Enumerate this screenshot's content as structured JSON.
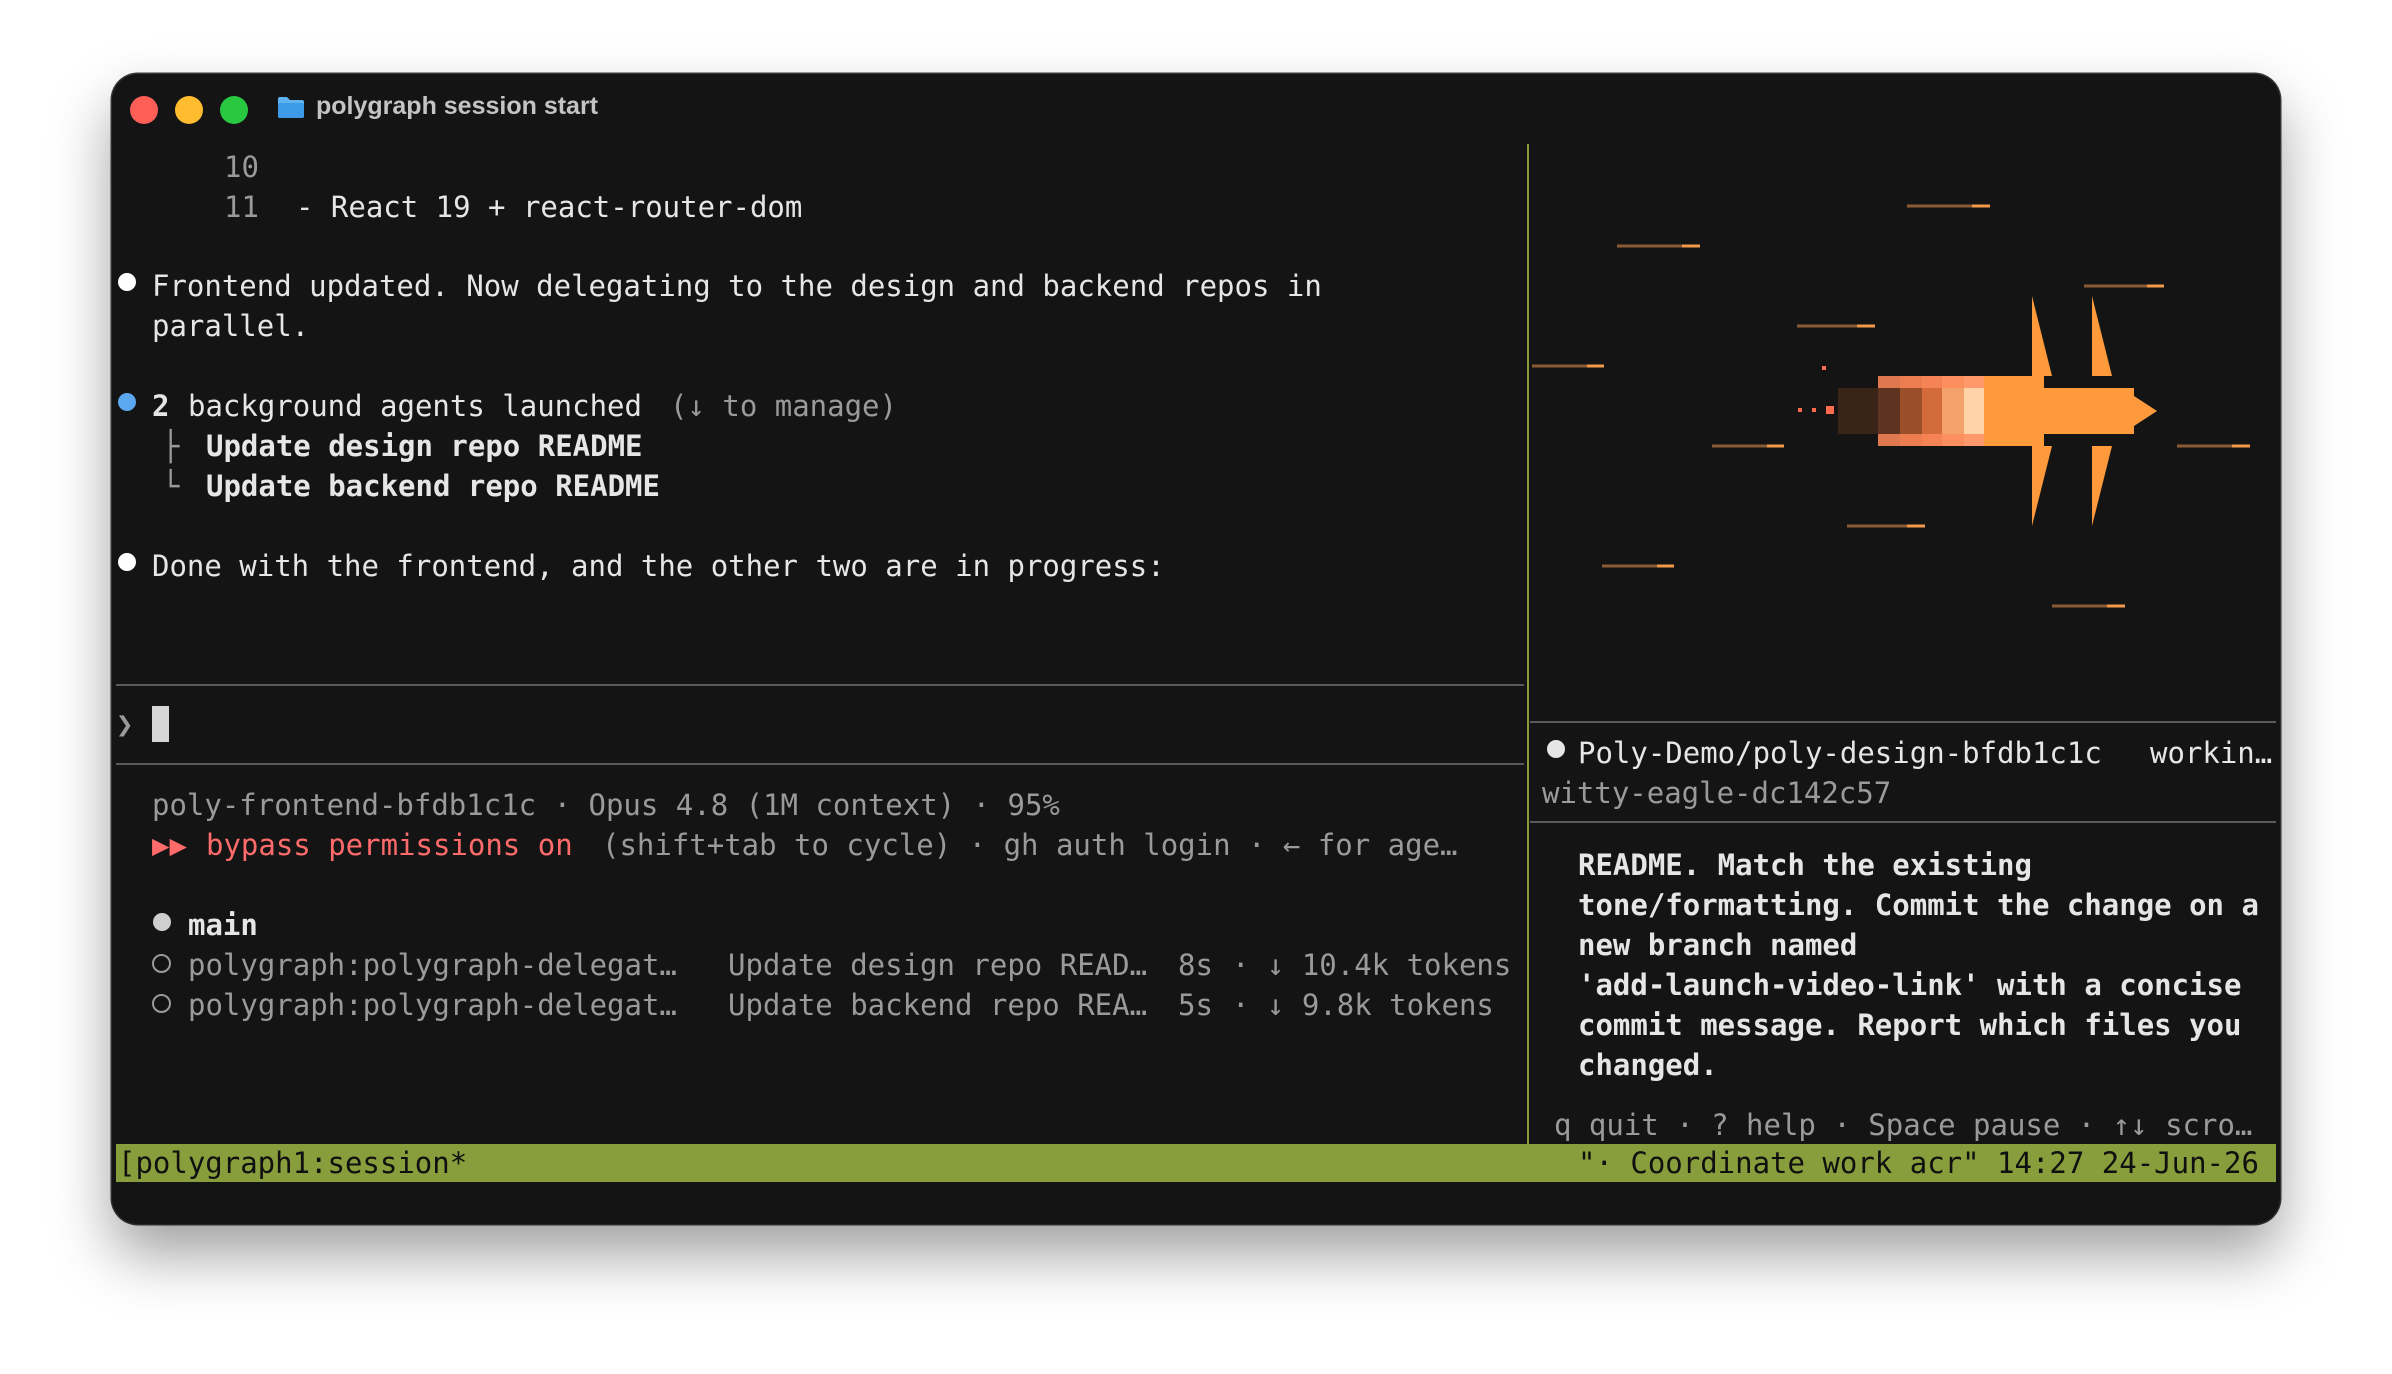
{
  "window": {
    "title": "polygraph session start",
    "colors": {
      "background": "#141414",
      "status_bar": "#889d3b",
      "accent_orange": "#ff9a3c",
      "error_red": "#ff6b6b",
      "info_blue": "#5ba7f0"
    }
  },
  "left_pane": {
    "code_lines": [
      {
        "number": "10",
        "text": ""
      },
      {
        "number": "11",
        "text": "- React 19 + react-router-dom"
      }
    ],
    "message1": {
      "line1": "Frontend updated. Now delegating to the design and backend repos in",
      "line2": "parallel."
    },
    "agents": {
      "count": "2",
      "text": "background agents launched",
      "hint": "(↓ to manage)",
      "branch_chars": [
        "├",
        "└"
      ],
      "items": [
        "Update design repo README",
        "Update backend repo README"
      ]
    },
    "message2": "Done with the frontend, and the other two are in progress:",
    "prompt_symbol": "❯",
    "info": {
      "line1": "poly-frontend-bfdb1c1c · Opus 4.8 (1M context) · 95%",
      "bypass_arrows": "▶▶",
      "bypass_text": "bypass permissions on",
      "bypass_rest": "(shift+tab to cycle) · gh auth login · ← for age…"
    },
    "tasks": {
      "main_label": "main",
      "rows": [
        {
          "name": "polygraph:polygraph-delegat…",
          "desc": "Update design repo READ…",
          "time": "8s",
          "tokens": "· ↓ 10.4k tokens"
        },
        {
          "name": "polygraph:polygraph-delegat…",
          "desc": "Update backend repo REA…",
          "time": "5s",
          "tokens": "· ↓ 9.8k tokens"
        }
      ]
    }
  },
  "right_pane": {
    "animation": "pixel-rocket-icon",
    "session": {
      "name": "Poly-Demo/poly-design-bfdb1c1c",
      "status": "workin…",
      "id": "witty-eagle-dc142c57"
    },
    "body_lines": [
      "README. Match the existing",
      "tone/formatting. Commit the change on a",
      "new branch named",
      "'add-launch-video-link' with a concise",
      "commit message. Report which files you",
      "changed."
    ],
    "help": "q quit · ? help · Space pause · ↑↓ scro…"
  },
  "status_bar": {
    "left": "[polygraph1:session*",
    "right": "\"· Coordinate work acr\" 14:27 24-Jun-26"
  }
}
